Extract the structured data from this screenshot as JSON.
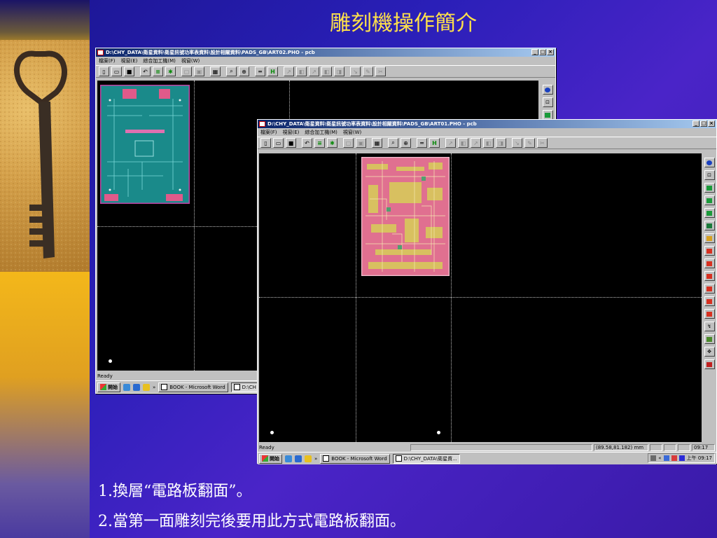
{
  "slide": {
    "title": "雕刻機操作簡介",
    "captions": [
      "1.換層“電路板翻面”。",
      "2.當第一面雕刻完後要用此方式電路板翻面。"
    ]
  },
  "window_back": {
    "title": "D:\\CHY_DATA\\衛星資料\\衛星訊號功率表資料\\設計相關資料\\PADS_GB\\ART02.PHO - pcb",
    "menu": [
      "檔案(F)",
      "視窗(E)",
      "綜合加工機(M)",
      "視窗(W)"
    ],
    "status": "Ready",
    "taskbar": {
      "start_label": "開始",
      "task1": "BOOK - Microsoft Word",
      "task2": "D:\\CH"
    }
  },
  "window_front": {
    "title": "D:\\CHY_DATA\\衛星資料\\衛星訊號功率表資料\\設計相關資料\\PADS_GB\\ART01.PHO - pcb",
    "menu": [
      "檔案(F)",
      "視窗(E)",
      "綜合加工機(M)",
      "視窗(W)"
    ],
    "status": "Ready",
    "coords": "(89.58,81.182) mm",
    "time_status": "09:17",
    "taskbar": {
      "start_label": "開始",
      "task1": "BOOK - Microsoft Word",
      "task2": "D:\\CHY_DATA\\衛星資...",
      "clock": "上午 09:17"
    }
  },
  "window_controls": [
    "_",
    "□",
    "×"
  ],
  "colors": {
    "title": "#ffe14a",
    "caption": "#ffffff",
    "pcb_board_teal": "#1a8a8a",
    "pcb_board_pink": "#e07090",
    "pcb_board_frame": "#c040a0"
  },
  "icons": {
    "toolbar": [
      "new-file-icon",
      "open-folder-icon",
      "save-icon",
      "undo-icon",
      "layer-stack-icon",
      "layer-flip-icon",
      "grid-icon",
      "window-icon",
      "table-icon",
      "zoom-icon",
      "zoom-window-icon",
      "ruler-icon",
      "dimension-icon",
      "route-icon",
      "drill-icon",
      "mill-icon",
      "cut-icon"
    ],
    "right_toolbar": [
      "home-icon",
      "zoom-fit-icon",
      "layer-1-icon",
      "layer-2-icon",
      "layer-3-icon",
      "layer-4-icon",
      "layer-5-icon",
      "tool-1-icon",
      "tool-2-icon",
      "tool-3-icon",
      "tool-4-icon",
      "tool-5-icon",
      "tool-6-icon",
      "tool-7-icon",
      "probe-icon",
      "move-icon",
      "stop-icon"
    ]
  }
}
